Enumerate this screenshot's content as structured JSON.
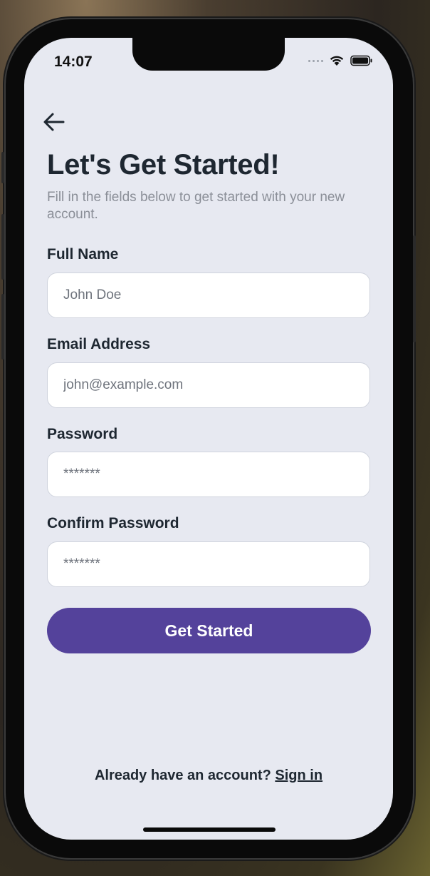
{
  "status_bar": {
    "time": "14:07",
    "icons": [
      "cellular-signal-icon",
      "wifi-icon",
      "battery-icon"
    ]
  },
  "header": {
    "back_icon": "arrow-left-icon",
    "title": "Let's Get Started!",
    "subtitle": "Fill in the fields below to get started with your new account."
  },
  "form": {
    "full_name": {
      "label": "Full Name",
      "placeholder": "John Doe",
      "value": ""
    },
    "email": {
      "label": "Email Address",
      "placeholder": "john@example.com",
      "value": ""
    },
    "password": {
      "label": "Password",
      "placeholder": "*******",
      "value": ""
    },
    "confirm_password": {
      "label": "Confirm Password",
      "placeholder": "*******",
      "value": ""
    },
    "submit_label": "Get Started"
  },
  "footer": {
    "prompt": "Already have an account?",
    "link_label": "Sign in"
  },
  "colors": {
    "accent": "#54429b",
    "background": "#e7e9f1",
    "heading": "#1e2731",
    "muted": "#8b8f98"
  }
}
